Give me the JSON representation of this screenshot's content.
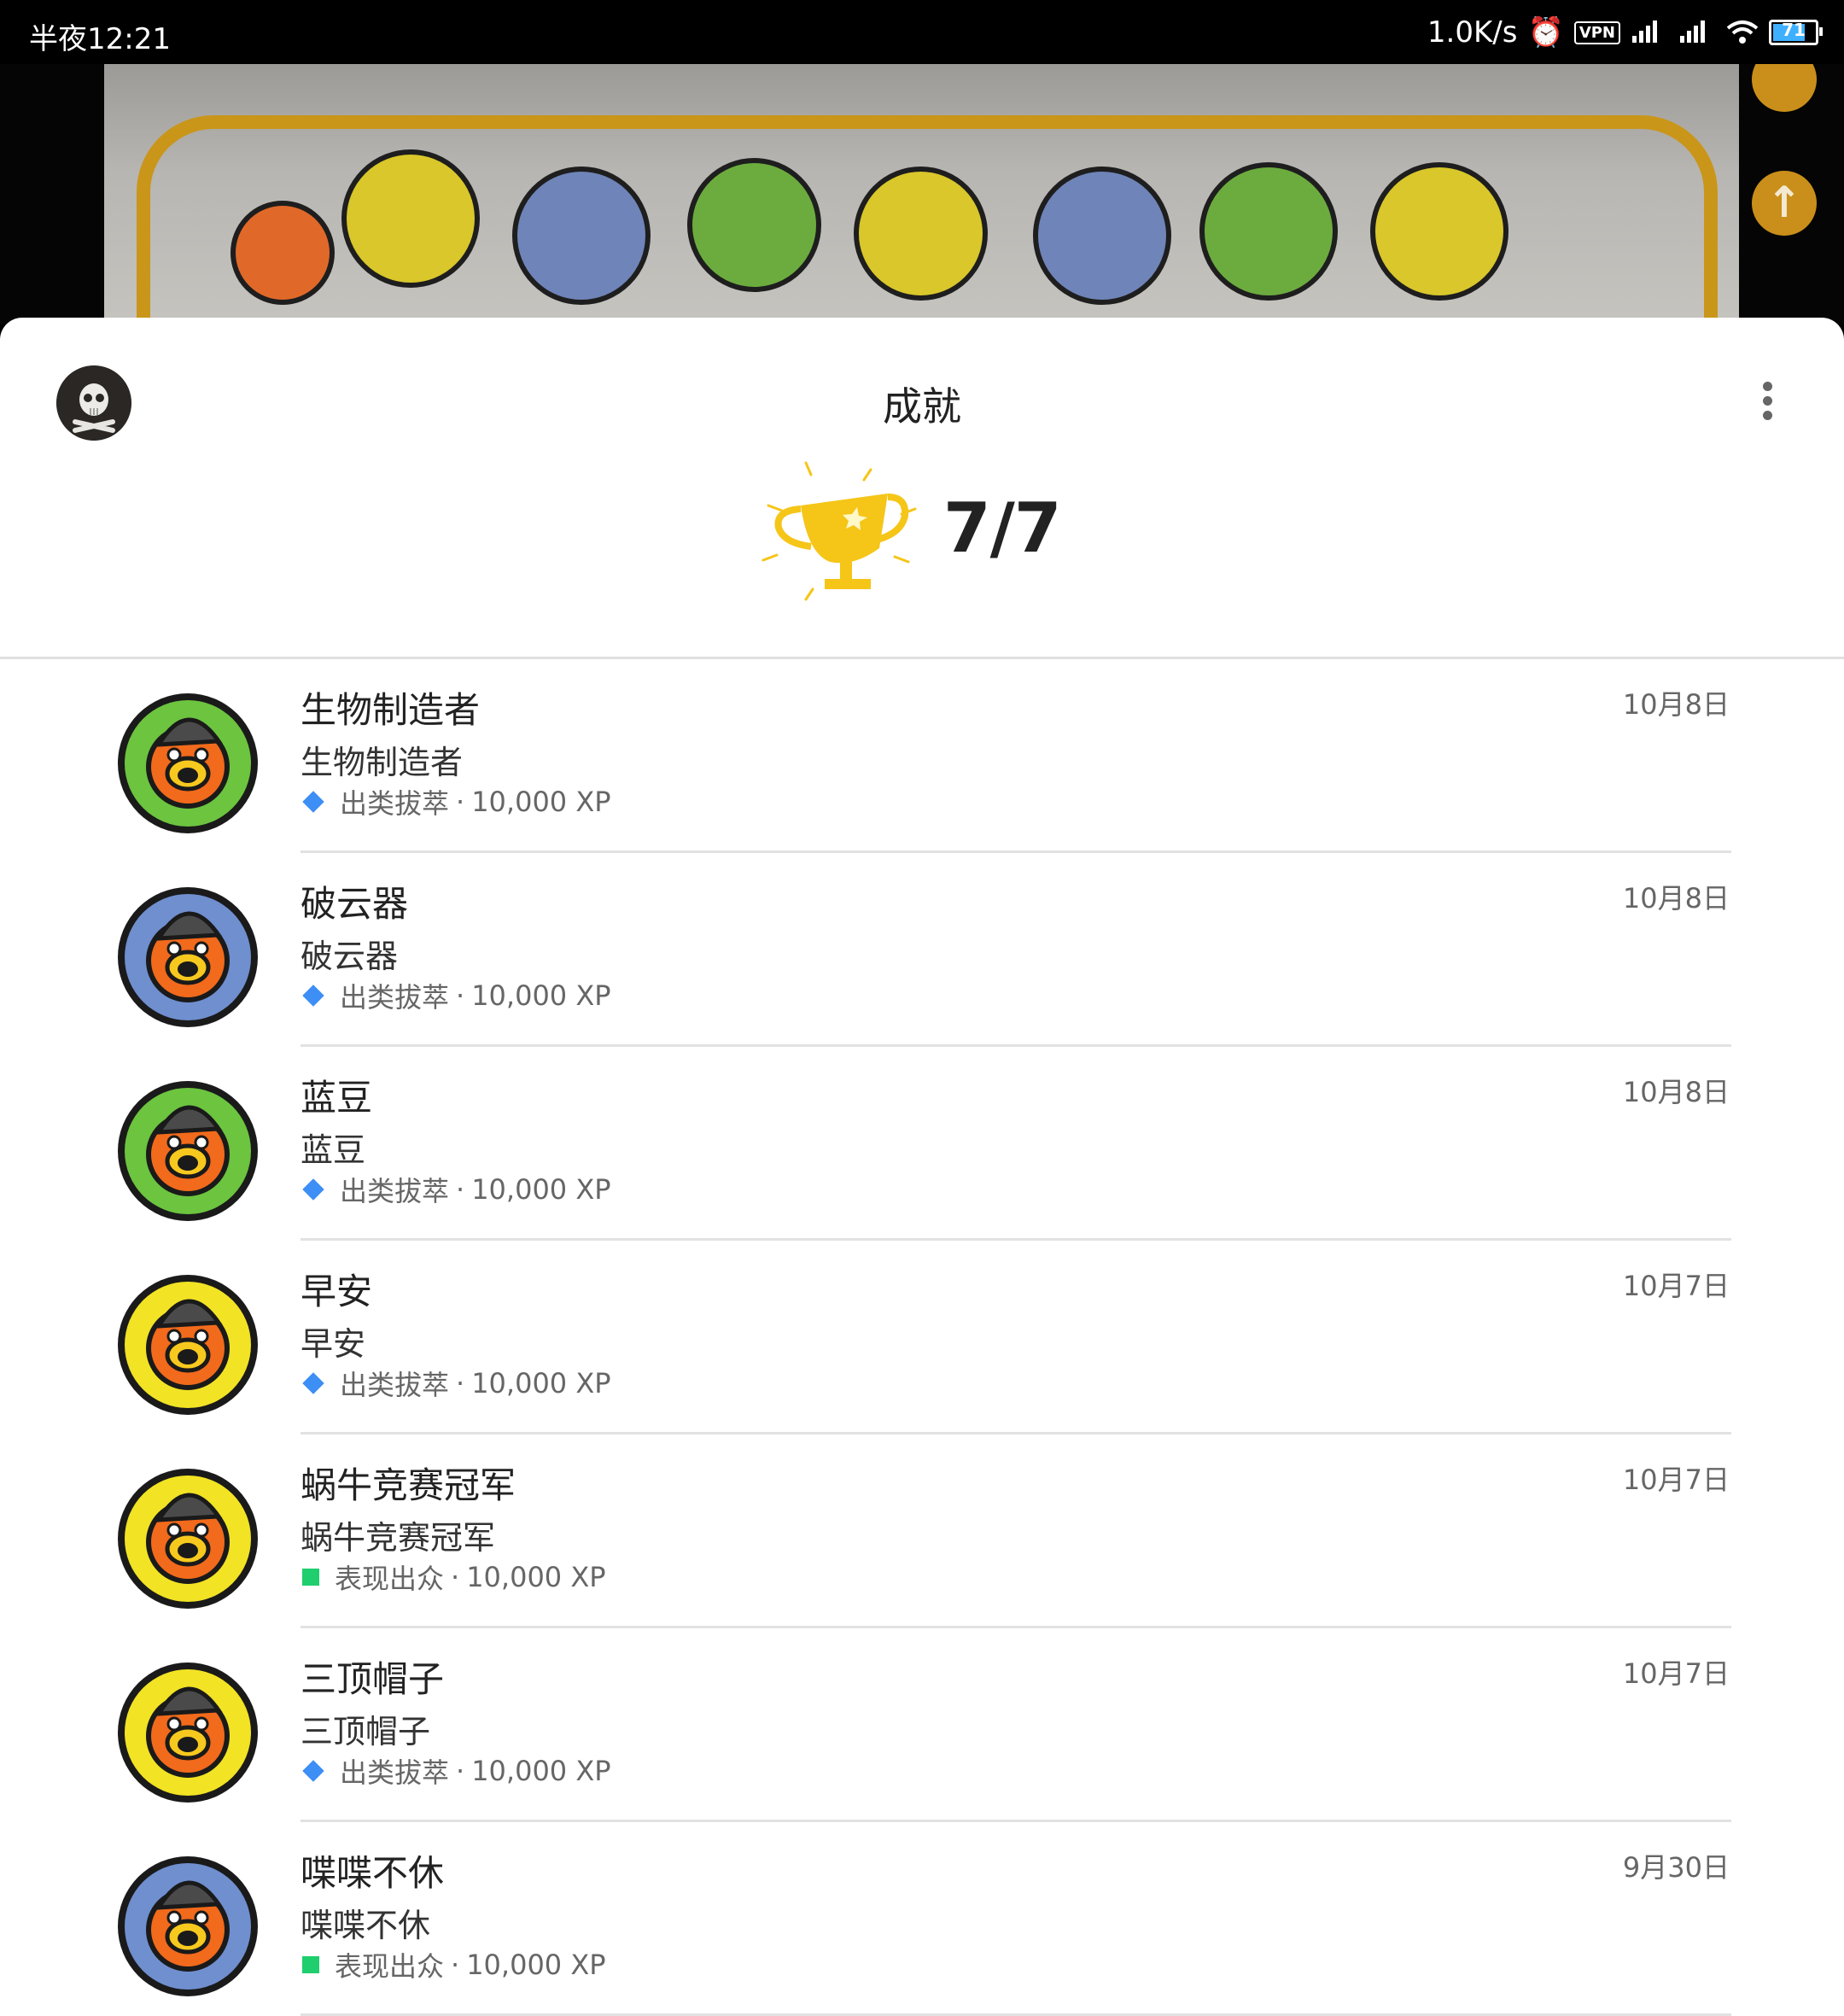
{
  "status_bar": {
    "time": "半夜12:21",
    "net_speed": "1.0K/s",
    "vpn": "VPN",
    "battery": "71"
  },
  "sheet": {
    "title": "成就",
    "progress": "7/7"
  },
  "achievements": [
    {
      "name": "生物制造者",
      "desc": "生物制造者",
      "rarity": "出类拔萃",
      "xp": "10,000 XP",
      "date": "10月8日",
      "badge_color": "#6cc43f",
      "marker": "gem",
      "icon": "star-creature-badge"
    },
    {
      "name": "破云器",
      "desc": "破云器",
      "rarity": "出类拔萃",
      "xp": "10,000 XP",
      "date": "10月8日",
      "badge_color": "#6f8fcf",
      "marker": "gem",
      "icon": "cloud-creature-badge"
    },
    {
      "name": "蓝豆",
      "desc": "蓝豆",
      "rarity": "出类拔萃",
      "xp": "10,000 XP",
      "date": "10月8日",
      "badge_color": "#6cc43f",
      "marker": "gem",
      "icon": "bean-creature-badge"
    },
    {
      "name": "早安",
      "desc": "早安",
      "rarity": "出类拔萃",
      "xp": "10,000 XP",
      "date": "10月7日",
      "badge_color": "#f2e324",
      "marker": "gem",
      "icon": "box-creature-badge"
    },
    {
      "name": "蜗牛竞赛冠军",
      "desc": "蜗牛竞赛冠军",
      "rarity": "表现出众",
      "xp": "10,000 XP",
      "date": "10月7日",
      "badge_color": "#f2e324",
      "marker": "square",
      "icon": "snail-creature-badge"
    },
    {
      "name": "三顶帽子",
      "desc": "三顶帽子",
      "rarity": "出类拔萃",
      "xp": "10,000 XP",
      "date": "10月7日",
      "badge_color": "#f2e324",
      "marker": "gem",
      "icon": "hat-creature-badge"
    },
    {
      "name": "喋喋不休",
      "desc": "喋喋不休",
      "rarity": "表现出众",
      "xp": "10,000 XP",
      "date": "9月30日",
      "badge_color": "#6f8fcf",
      "marker": "square",
      "icon": "talk-creature-badge"
    }
  ],
  "separator": "·",
  "colors": {
    "gem": "#3d8ef5",
    "square": "#1fce6d",
    "trophy": "#f5c518",
    "orange": "#f26a1b"
  }
}
